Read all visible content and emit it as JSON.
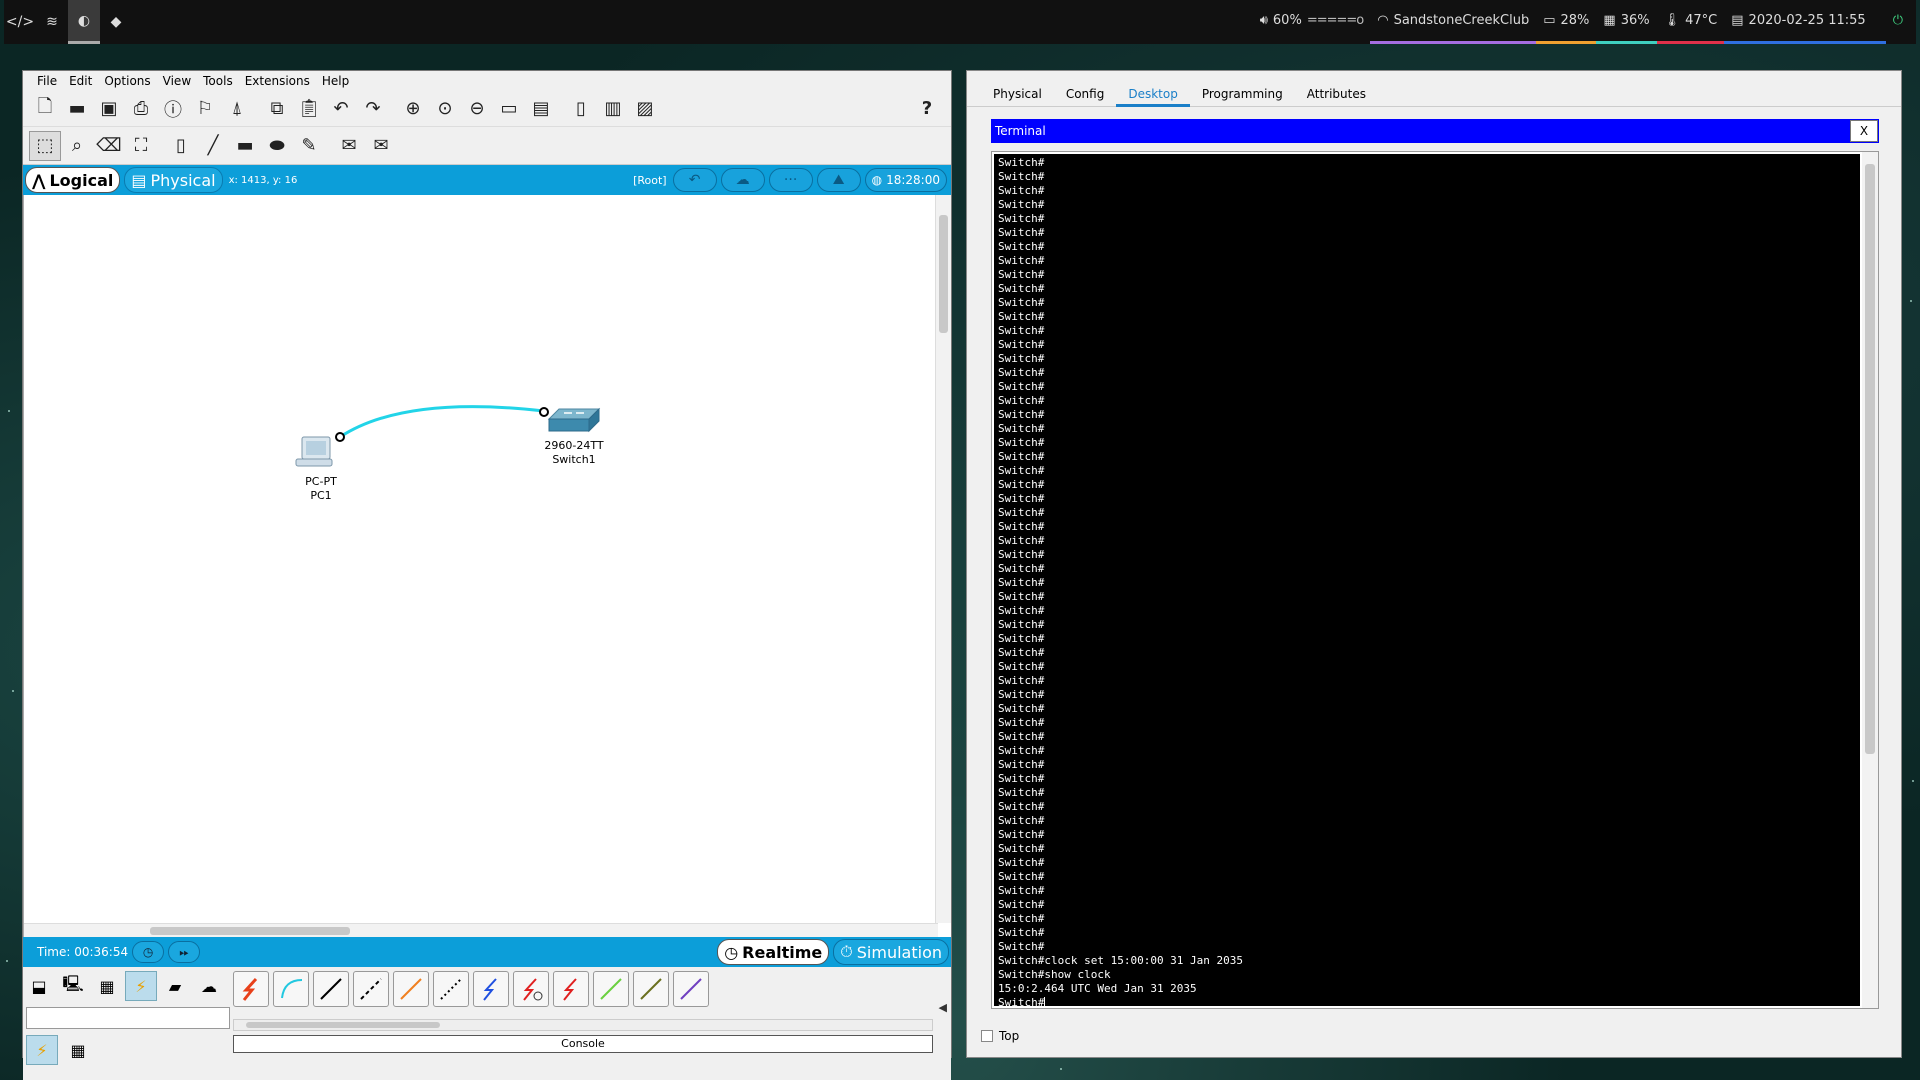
{
  "topbar": {
    "workspaces": [
      {
        "icon": "code-icon",
        "glyph": "</>"
      },
      {
        "icon": "spotify-icon",
        "glyph": "≋"
      },
      {
        "icon": "moon-icon",
        "glyph": "◐"
      },
      {
        "icon": "git-icon",
        "glyph": "◆"
      }
    ],
    "volume": "60%",
    "volume_bar": "=====o",
    "wifi": "SandstoneCreekClub",
    "battery": "28%",
    "memory": "36%",
    "temperature": "47°C",
    "datetime": "2020-02-25 11:55",
    "colors": {
      "wifi": "#a56de2",
      "battery": "#f0a030",
      "memory": "#3fd0c0",
      "temp": "#e0304a",
      "date": "#2f6fe0"
    }
  },
  "pt": {
    "menu": [
      "File",
      "Edit",
      "Options",
      "View",
      "Tools",
      "Extensions",
      "Help"
    ],
    "logical_tab": "Logical",
    "physical_tab": "Physical",
    "coords": "x: 1413, y: 16",
    "root": "[Root]",
    "clock": "18:28:00",
    "devices": {
      "pc": {
        "model": "PC-PT",
        "name": "PC1"
      },
      "switch": {
        "model": "2960-24TT",
        "name": "Switch1"
      }
    },
    "time": "Time: 00:36:54",
    "realtime": "Realtime",
    "simulation": "Simulation",
    "console": "Console"
  },
  "switch_window": {
    "tabs": [
      "Physical",
      "Config",
      "Desktop",
      "Programming",
      "Attributes"
    ],
    "active_tab": "Desktop",
    "terminal_title": "Terminal",
    "close": "X",
    "prompt_line": "Switch#",
    "prompt_repeat": 57,
    "final_lines": [
      "Switch#clock set 15:00:00 31 Jan 2035",
      "Switch#show clock",
      "15:0:2.464 UTC Wed Jan 31 2035",
      "Switch#"
    ],
    "top_checkbox": "Top"
  }
}
